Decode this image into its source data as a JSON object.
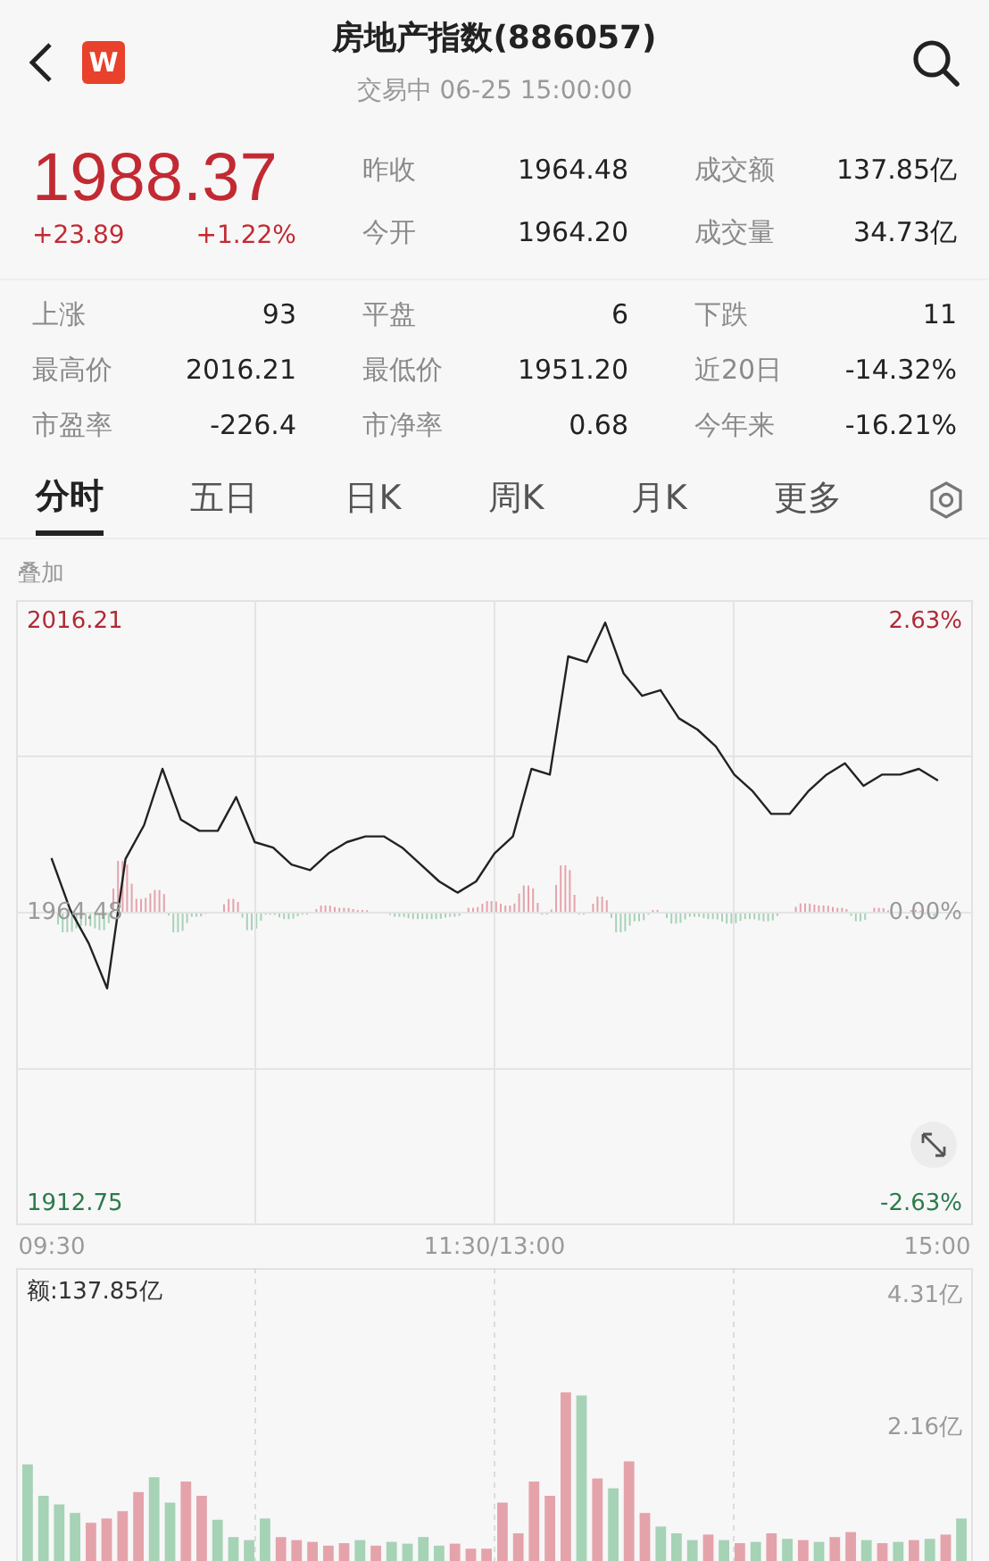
{
  "header": {
    "logo": "W",
    "title": "房地产指数(886057)",
    "subtitle": "交易中 06-25 15:00:00"
  },
  "quote": {
    "price": "1988.37",
    "change": "+23.89",
    "change_pct": "+1.22%",
    "up": true
  },
  "top_stats": [
    {
      "label": "昨收",
      "value": "1964.48"
    },
    {
      "label": "成交额",
      "value": "137.85亿"
    },
    {
      "label": "今开",
      "value": "1964.20"
    },
    {
      "label": "成交量",
      "value": "34.73亿"
    }
  ],
  "stats": [
    {
      "label": "上涨",
      "value": "93"
    },
    {
      "label": "平盘",
      "value": "6"
    },
    {
      "label": "下跌",
      "value": "11"
    },
    {
      "label": "最高价",
      "value": "2016.21"
    },
    {
      "label": "最低价",
      "value": "1951.20"
    },
    {
      "label": "近20日",
      "value": "-14.32%"
    },
    {
      "label": "市盈率",
      "value": "-226.4"
    },
    {
      "label": "市净率",
      "value": "0.68"
    },
    {
      "label": "今年来",
      "value": "-16.21%"
    }
  ],
  "tabs": [
    {
      "label": "分时",
      "selected": true
    },
    {
      "label": "五日",
      "selected": false
    },
    {
      "label": "日K",
      "selected": false
    },
    {
      "label": "周K",
      "selected": false
    },
    {
      "label": "月K",
      "selected": false
    },
    {
      "label": "更多",
      "selected": false
    }
  ],
  "overlay_label": "叠加",
  "price_chart": {
    "percent_labels": [
      "2.63%",
      "0.00%",
      "-2.63%"
    ],
    "chart_data": {
      "type": "line",
      "grid": true,
      "categories": [
        "09:30",
        null,
        null,
        null,
        null,
        null,
        null,
        null,
        null,
        null,
        null,
        null,
        null,
        null,
        null,
        null,
        null,
        null,
        null,
        null,
        null,
        null,
        null,
        null,
        "11:30/13:00",
        null,
        null,
        null,
        null,
        null,
        null,
        null,
        null,
        null,
        null,
        null,
        null,
        null,
        null,
        null,
        null,
        null,
        null,
        null,
        null,
        null,
        null,
        null,
        "15:00"
      ],
      "series": [
        {
          "color": "#222222",
          "values": [
            1974,
            1965,
            1959,
            1951,
            1974,
            1980,
            1990,
            1981,
            1979,
            1979,
            1985,
            1977,
            1976,
            1973,
            1972,
            1975,
            1977,
            1978,
            1978,
            1976,
            1973,
            1970,
            1968,
            1970,
            1975,
            1978,
            1990,
            1989,
            2010,
            2009,
            2016,
            2007,
            2003,
            2004,
            1999,
            1997,
            1994,
            1989,
            1986,
            1982,
            1982,
            1986,
            1989,
            1991,
            1987,
            1989,
            1989,
            1990,
            1988
          ]
        }
      ],
      "ylim": [
        1908.9,
        2020.0
      ],
      "yticks": [
        {
          "value": 2016.21,
          "label": "2016.21"
        },
        {
          "value": 1964.48,
          "label": "1964.48"
        },
        {
          "value": 1912.75,
          "label": "1912.75"
        }
      ]
    }
  },
  "volume_chart": {
    "label": "额:137.85亿",
    "chart_data": {
      "type": "bar",
      "stacked": true,
      "grid": true,
      "categories": [
        null,
        null,
        null,
        null,
        null,
        null,
        null,
        null,
        null,
        null,
        null,
        null,
        null,
        null,
        null,
        null,
        null,
        null,
        null,
        null,
        null,
        null,
        null,
        null,
        null,
        null,
        null,
        null,
        null,
        null,
        null,
        null,
        null,
        null,
        null,
        null,
        null,
        null,
        null,
        null,
        null,
        null,
        null,
        null,
        null,
        null,
        null,
        null,
        null,
        null,
        null,
        null,
        null,
        null,
        null,
        null,
        null,
        null,
        null,
        null
      ],
      "ylim": [
        0,
        4.7
      ],
      "yticks": [
        {
          "value": 4.31,
          "label": "4.31亿"
        },
        {
          "value": 2.16,
          "label": "2.16亿"
        }
      ],
      "series": [
        {
          "color": "#e4a3ab",
          "values": [
            null,
            null,
            null,
            null,
            0.62,
            0.69,
            0.81,
            1.12,
            null,
            null,
            1.29,
            1.06,
            null,
            null,
            null,
            null,
            0.39,
            0.34,
            0.31,
            0.25,
            0.29,
            null,
            0.25,
            null,
            null,
            null,
            null,
            0.28,
            0.2,
            0.2,
            0.95,
            0.45,
            1.29,
            1.06,
            2.74,
            null,
            1.34,
            null,
            1.62,
            0.78,
            null,
            null,
            null,
            0.43,
            null,
            0.29,
            null,
            0.45,
            null,
            0.34,
            null,
            0.39,
            0.47,
            null,
            0.29,
            null,
            0.34,
            null,
            0.43,
            null
          ]
        },
        {
          "color": "#a6d2b6",
          "values": [
            1.57,
            1.06,
            0.92,
            0.78,
            null,
            null,
            null,
            null,
            1.36,
            0.95,
            null,
            null,
            0.67,
            0.39,
            0.34,
            0.69,
            null,
            null,
            null,
            null,
            null,
            0.34,
            null,
            0.31,
            0.28,
            0.39,
            0.25,
            null,
            null,
            null,
            null,
            null,
            null,
            null,
            null,
            2.69,
            null,
            1.18,
            null,
            null,
            0.56,
            0.45,
            0.34,
            null,
            0.34,
            null,
            0.31,
            null,
            0.36,
            null,
            0.31,
            null,
            null,
            0.34,
            null,
            0.31,
            null,
            0.36,
            null,
            0.69
          ]
        }
      ]
    }
  }
}
